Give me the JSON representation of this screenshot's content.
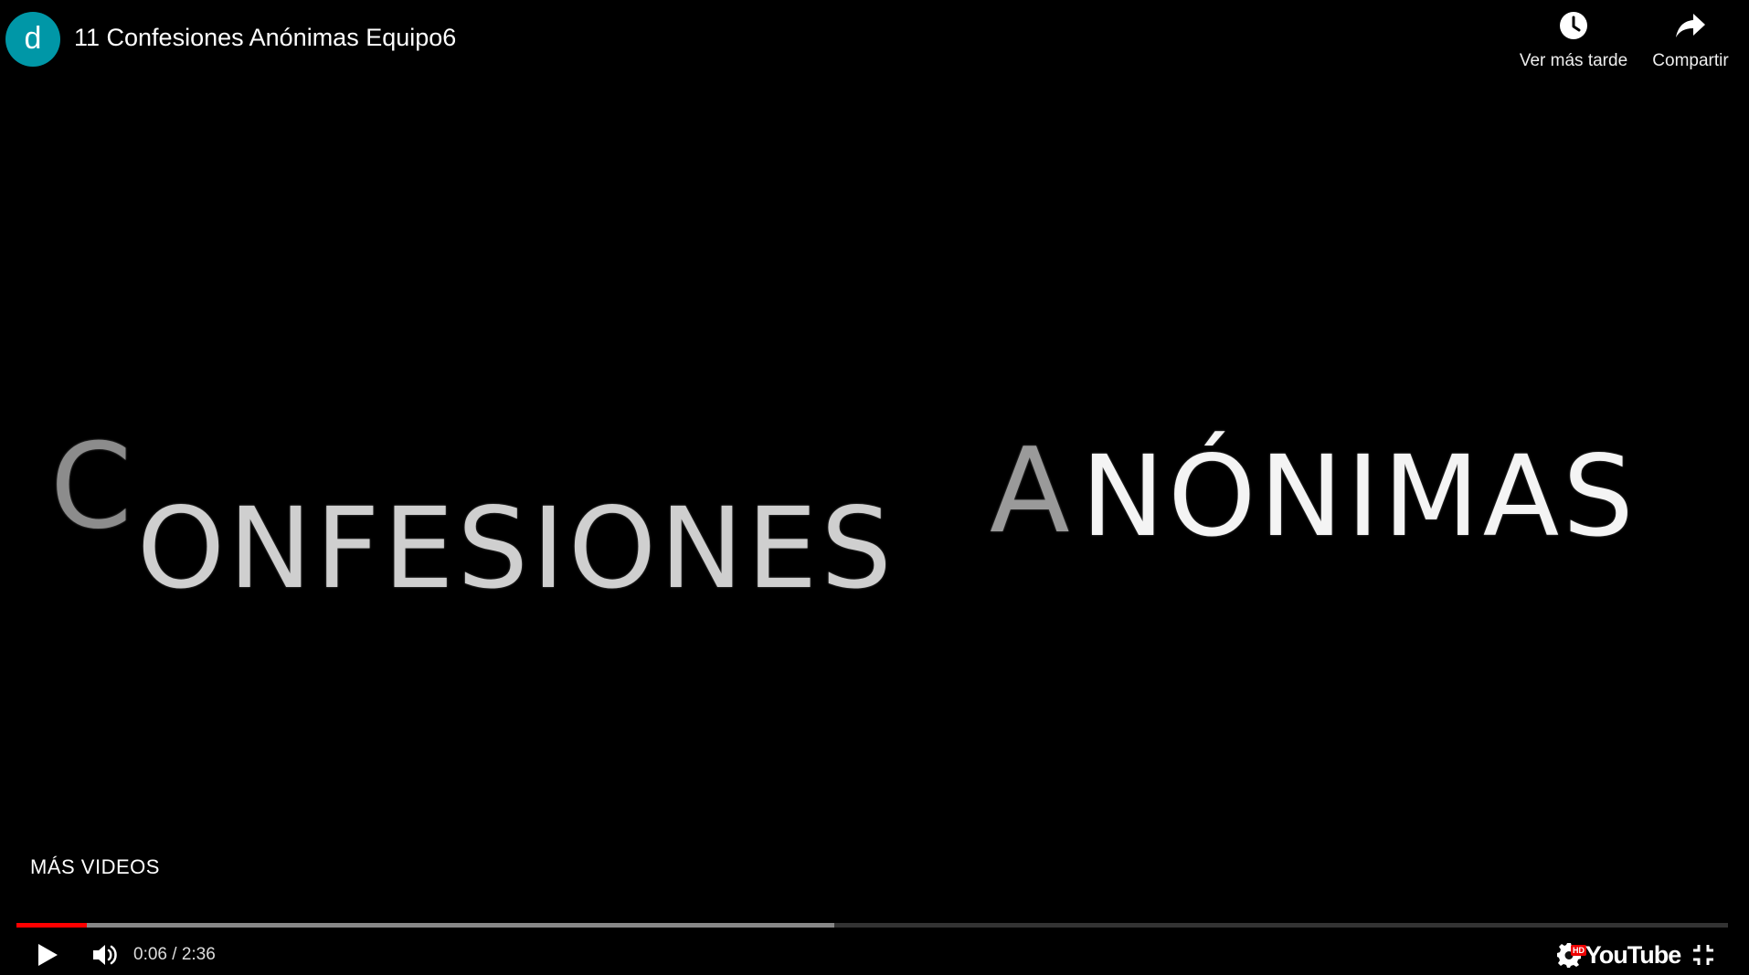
{
  "header": {
    "channel_avatar_letter": "d",
    "video_title": "11 Confesiones Anónimas Equipo6",
    "watch_later_label": "Ver más tarde",
    "share_label": "Compartir"
  },
  "video": {
    "title_card": {
      "word1_cap": "C",
      "word1_rest": "ONFESIONES",
      "word2_cap": "A",
      "word2_rest": "NÓNIMAS"
    }
  },
  "more_videos_label": "MÁS VIDEOS",
  "player": {
    "current_time": "0:06",
    "duration": "2:36",
    "time_text": "0:06 / 2:36",
    "played_fraction": 0.041,
    "buffered_fraction": 0.478,
    "hd_badge": "HD",
    "logo_text": "YouTube"
  },
  "colors": {
    "progress_played": "#ff0000",
    "avatar_bg": "#0097a7",
    "hd_badge_bg": "#ee0000"
  },
  "icons": {
    "watch_later": "clock-icon",
    "share": "share-arrow-icon",
    "play": "play-icon",
    "volume": "volume-icon",
    "settings": "gear-icon",
    "fullscreen_exit": "fullscreen-exit-icon"
  }
}
